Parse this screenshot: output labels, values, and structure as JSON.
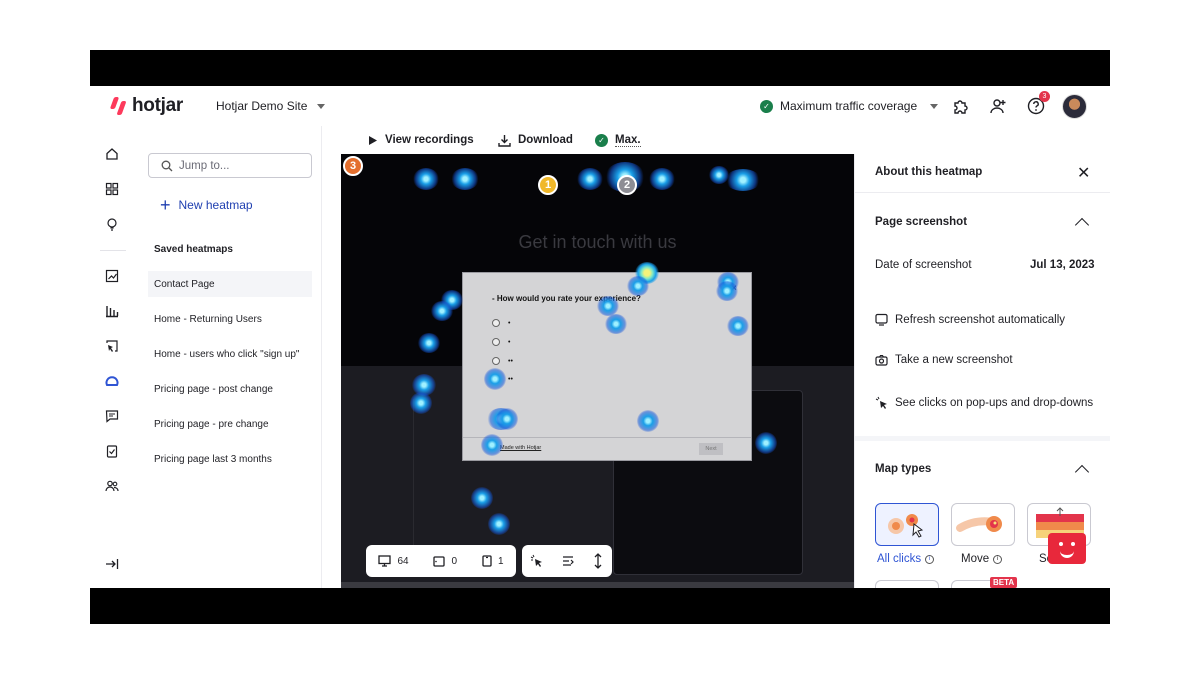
{
  "app": {
    "logo_text": "hotjar",
    "site": "Hotjar Demo Site",
    "traffic": "Maximum traffic coverage",
    "help_badge": "3"
  },
  "search": {
    "placeholder": "Jump to..."
  },
  "sidepanel": {
    "new_heatmap": "New heatmap",
    "saved_title": "Saved heatmaps",
    "items": [
      {
        "label": "Contact Page"
      },
      {
        "label": "Home - Returning Users"
      },
      {
        "label": "Home - users who click \"sign up\""
      },
      {
        "label": "Pricing page - post change"
      },
      {
        "label": "Pricing page - pre change"
      },
      {
        "label": "Pricing page last 3 months"
      }
    ]
  },
  "toolbar": {
    "view_recordings": "View recordings",
    "download": "Download",
    "max": "Max."
  },
  "heatmap": {
    "page_title": "Get in touch with us",
    "markers": [
      "1",
      "2",
      "3"
    ],
    "popup": {
      "question": "- How would you rate your experience?",
      "close": "×",
      "made_with": "Made with Hotjar",
      "next": "Next",
      "options": [
        "•",
        "•",
        "••",
        "••"
      ]
    },
    "counts": {
      "desktop": "64",
      "tablet": "0",
      "mobile": "1"
    }
  },
  "rpanel": {
    "title": "About this heatmap",
    "page_screenshot": "Page screenshot",
    "date_label": "Date of screenshot",
    "date_value": "Jul 13, 2023",
    "refresh": "Refresh screenshot automatically",
    "take_new": "Take a new screenshot",
    "see_clicks": "See clicks on pop-ups and drop-downs",
    "map_types": "Map types",
    "types": [
      {
        "label": "All clicks"
      },
      {
        "label": "Move"
      },
      {
        "label": "Sc"
      }
    ],
    "beta": "BETA"
  },
  "colors": {
    "brand": "#fd3a5c",
    "link": "#1f3fb0",
    "success": "#1a7f4b",
    "badge": "#e3344b",
    "active_tile": "#2f55d4"
  }
}
